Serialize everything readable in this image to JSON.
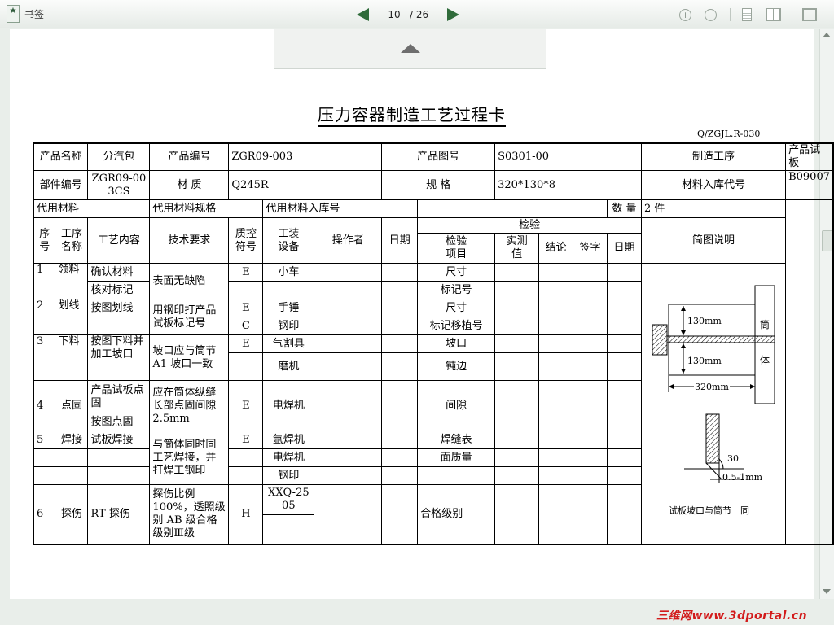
{
  "toolbar": {
    "bookmarks_label": "书签",
    "current_page": "10",
    "total_pages": "/ 26"
  },
  "doc": {
    "title": "压力容器制造工艺过程卡",
    "code": "Q/ZGJL.R-030"
  },
  "header": {
    "r1": [
      "产品名称",
      "分汽包",
      "产品编号",
      "ZGR09-003",
      "产品图号",
      "S0301-00",
      "制造工序",
      "产品试板"
    ],
    "r2": [
      "部件编号",
      "ZGR09-00\n3CS",
      "材 质",
      "Q245R",
      "规 格",
      "320*130*8",
      "材料入库代号",
      "B09007"
    ],
    "r3": [
      "代用材料",
      "",
      "代用材料规格",
      "",
      "代用材料入库号",
      "",
      "数 量",
      "2 件"
    ]
  },
  "columns": {
    "seq": "序\n号",
    "step": "工序\n名称",
    "content": "工艺内容",
    "req": "技术要求",
    "qc": "质控\n符号",
    "equip": "工装\n设备",
    "operator": "操作者",
    "date": "日期",
    "inspect": "检验",
    "inspect_item": "检验\n项目",
    "measured": "实测\n值",
    "conclusion": "结论",
    "sign": "签字",
    "inspect_date": "日期",
    "sketch": "简图说明"
  },
  "rows": {
    "r1": {
      "seq": "1",
      "step": "领料",
      "content": "确认材料",
      "req": "表面无缺陷",
      "qc": "E",
      "equip": "小车",
      "item": "尺寸"
    },
    "r2": {
      "content": "核对标记",
      "item": "标记号"
    },
    "r3": {
      "seq": "2",
      "step": "划线",
      "content": "按图划线",
      "req": "用钢印打产品试板标记号",
      "qc": "E",
      "equip": "手锤",
      "item": "尺寸"
    },
    "r4": {
      "qc": "C",
      "equip": "钢印",
      "item": "标记移植号"
    },
    "r5": {
      "seq": "3",
      "step": "下料",
      "content": "按图下料并加工坡口",
      "req": "坡口应与筒节A1 坡口一致",
      "qc": "E",
      "equip": "气割具",
      "item": "坡口"
    },
    "r6": {
      "equip": "磨机",
      "item": "钝边"
    },
    "r7": {
      "seq": "4",
      "step": "点固",
      "content": "产品试板点固",
      "req": "应在筒体纵缝长部点固间隙2.5mm",
      "qc": "E",
      "equip": "电焊机",
      "item": "间隙"
    },
    "r8": {
      "content": "按图点固"
    },
    "r9": {
      "seq": "5",
      "step": "焊接",
      "content": "试板焊接",
      "req": "与筒体同时同工艺焊接，并打焊工钢印",
      "qc": "E",
      "equip": "氩焊机",
      "item": "焊缝表"
    },
    "r10": {
      "equip": "电焊机",
      "item": "面质量"
    },
    "r11": {
      "equip": "钢印"
    },
    "r12": {
      "seq": "6",
      "step": "探伤",
      "content": "RT 探伤",
      "req": "探伤比例100%，透照级别 AB 级合格级别Ⅲ级",
      "qc": "H",
      "equip": "XXQ-25\n05",
      "item": "合格级别"
    }
  },
  "sketch": {
    "dim_height_top": "130mm",
    "dim_height_bottom": "130mm",
    "dim_width": "320mm",
    "shell_label_top": "筒",
    "shell_label_bottom": "体",
    "bevel_angle": "30",
    "gap_label": "0.5-1mm",
    "caption": "试板坡口与筒节　同"
  },
  "watermark": "三维网www.3dportal.cn"
}
